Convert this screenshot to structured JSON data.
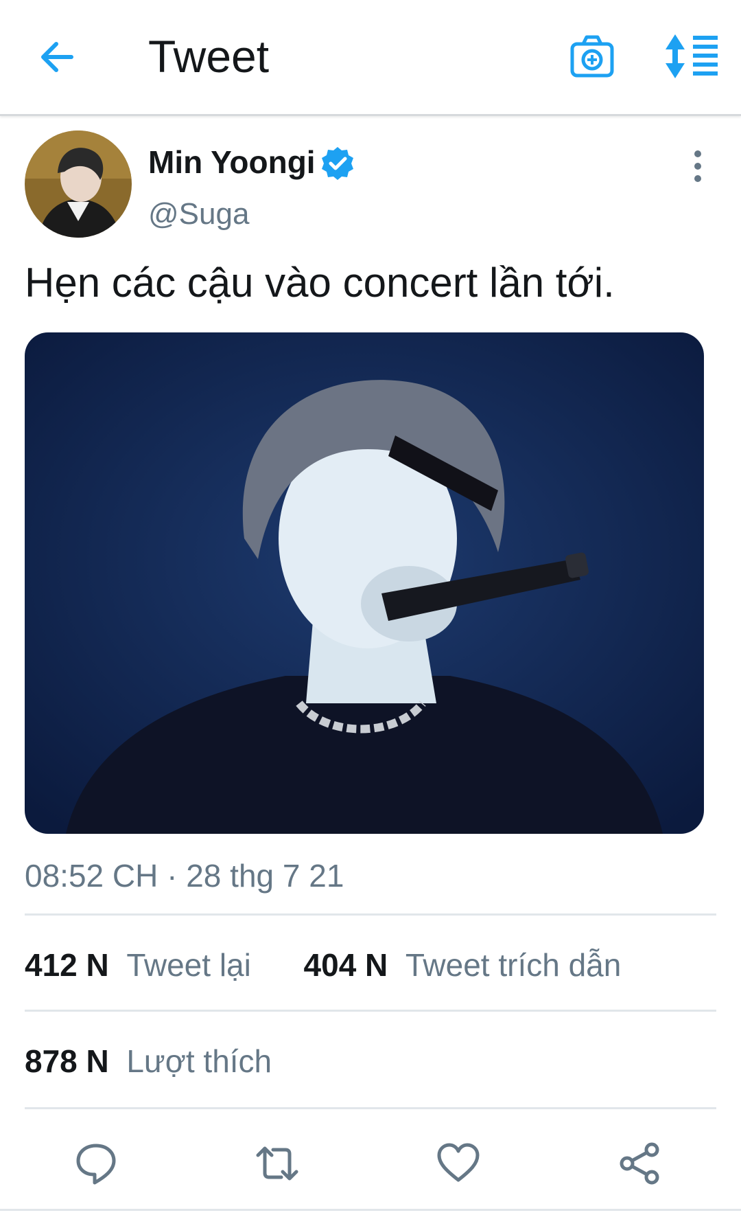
{
  "header": {
    "title": "Tweet",
    "back_icon": "arrow-left-icon",
    "camera_icon": "camera-plus-icon",
    "sort_icon": "sort-list-icon",
    "accent_color": "#1da1f2"
  },
  "tweet": {
    "display_name": "Min Yoongi",
    "verified": true,
    "handle": "@Suga",
    "text": "Hẹn các cậu vào concert lần tới.",
    "timestamp": "08:52 CH · 28 thg 7 21"
  },
  "stats": {
    "retweets_count": "412 N",
    "retweets_label": "Tweet lại",
    "quotes_count": "404 N",
    "quotes_label": "Tweet trích dẫn",
    "likes_count": "878 N",
    "likes_label": "Lượt thích"
  },
  "actions": [
    {
      "icon": "reply-icon"
    },
    {
      "icon": "retweet-icon"
    },
    {
      "icon": "heart-icon"
    },
    {
      "icon": "share-icon"
    }
  ],
  "colors": {
    "text_primary": "#14171a",
    "text_secondary": "#657786",
    "divider": "#e1e6ea",
    "verified": "#1da1f2"
  }
}
